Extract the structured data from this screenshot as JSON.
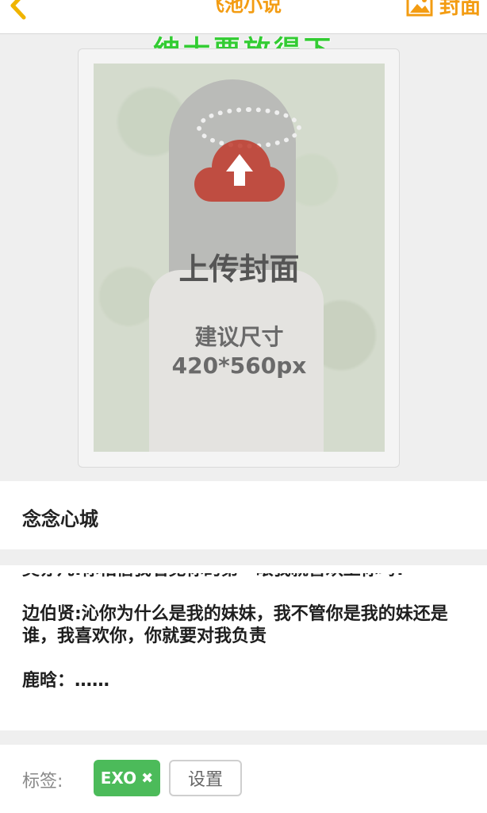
{
  "header": {
    "title": "飞池小说",
    "cover_button_label": "封面",
    "accent_color": "#f39c12"
  },
  "slogan": "绅士要放得下",
  "cover": {
    "upload_label": "上传封面",
    "size_hint": "建议尺寸",
    "size_value": "420*560px",
    "icon": "upload-cloud-icon",
    "icon_color": "#c0392b"
  },
  "book": {
    "title": "念念心城",
    "description": [
      "吴亦凡:你相信我看见你的第一眼我就喜欢上你吗?",
      "边伯贤:沁你为什么是我的妹妹，我不管你是我的妹还是谁，我喜欢你，你就要对我负责",
      "鹿晗：……"
    ]
  },
  "tags": {
    "label": "标签:",
    "items": [
      {
        "name": "EXO",
        "remove_icon": "close-icon"
      }
    ],
    "set_button": "设置",
    "chip_color": "#4cbb5a"
  }
}
